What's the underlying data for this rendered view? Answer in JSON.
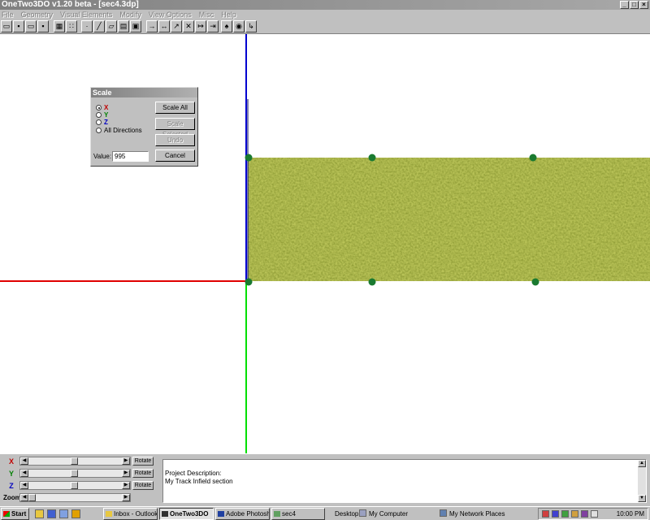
{
  "window": {
    "title": "OneTwo3DO v1.20 beta - [sec4.3dp]",
    "min": "_",
    "max": "□",
    "close": "×"
  },
  "menu": [
    "File",
    "Geometry",
    "Visual Elements",
    "Modify",
    "View Options",
    "Misc",
    "Help"
  ],
  "scale_dialog": {
    "title": "Scale",
    "options": [
      "X",
      "Y",
      "Z",
      "All Directions"
    ],
    "selected": "X",
    "buttons": [
      "Scale All",
      "Scale Selected",
      "Undo",
      "Cancel"
    ],
    "value_label": "Value:",
    "value": "995"
  },
  "controls": {
    "sliders": [
      {
        "label": "X",
        "color": "#c00000",
        "button": "Rotate",
        "position": 0.5
      },
      {
        "label": "Y",
        "color": "#008000",
        "button": "Rotate",
        "position": 0.5
      },
      {
        "label": "Z",
        "color": "#0000c0",
        "button": "Rotate",
        "position": 0.5
      },
      {
        "label": "Zoom",
        "color": "#000000",
        "position": 0.0
      }
    ],
    "description_label": "Project Description:",
    "description": "My Track Infield section"
  },
  "taskbar": {
    "start": "Start",
    "tasks": [
      "Inbox - Outlook...",
      "OneTwo3DO",
      "Adobe Photosh...",
      "sec4"
    ],
    "active_task": "OneTwo3DO",
    "desktop_links": [
      "Desktop",
      "My Computer",
      "My Network Places"
    ],
    "time": "10:00 PM"
  },
  "colors": {
    "x_axis": "#e00000",
    "y_axis": "#00e000",
    "z_axis": "#0000d0",
    "grass": "#5a6a20",
    "vertex": "#1a7a30"
  }
}
